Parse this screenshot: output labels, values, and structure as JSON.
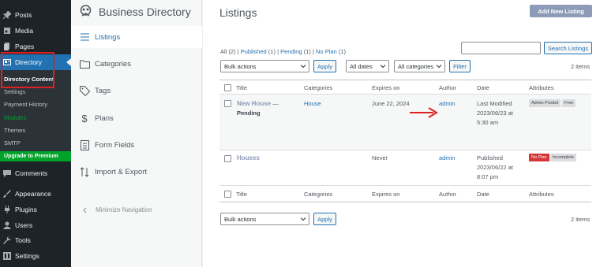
{
  "wp_menu": {
    "posts": "Posts",
    "media": "Media",
    "pages": "Pages",
    "directory": "Directory",
    "submenu": [
      "Directory Content",
      "Settings",
      "Payment History",
      "Modules",
      "Themes",
      "SMTP"
    ],
    "upgrade": "Upgrade to Premium",
    "comments": "Comments",
    "appearance": "Appearance",
    "plugins": "Plugins",
    "users": "Users",
    "tools": "Tools",
    "settings": "Settings"
  },
  "bd_nav": {
    "title": "Business Directory",
    "items": [
      "Listings",
      "Categories",
      "Tags",
      "Plans",
      "Form Fields",
      "Import & Export"
    ],
    "minimize": "Minimize Navigation"
  },
  "main": {
    "title": "Listings",
    "add_new": "Add New Listing",
    "filters": {
      "all": "All",
      "all_count": "(2)",
      "published": "Published",
      "published_count": "(1)",
      "pending": "Pending",
      "pending_count": "(1)",
      "no_plan": "No Plan",
      "no_plan_count": "(1)",
      "sep": "|"
    },
    "search_button": "Search Listings",
    "bulk_actions": "Bulk actions",
    "apply": "Apply",
    "all_dates": "All dates",
    "all_categories": "All categories",
    "filter": "Filter",
    "items_count": "2 items",
    "columns": [
      "Title",
      "Categories",
      "Expires on",
      "Author",
      "Date",
      "Attributes"
    ],
    "rows": [
      {
        "title": "New House",
        "dash": "—",
        "state": "Pending",
        "category": "House",
        "expires": "June 22, 2024",
        "author": "admin",
        "date_label": "Last Modified",
        "date": "2023/06/23 at",
        "time": "5:30 am",
        "badges": [
          "Admin Posted",
          "Free"
        ]
      },
      {
        "title": "Houses",
        "category": "",
        "expires": "Never",
        "author": "admin",
        "date_label": "Published",
        "date": "2023/06/22 at",
        "time": "8:07 pm",
        "badges": [
          "No Plan",
          "Incomplete"
        ]
      }
    ]
  },
  "colors": {
    "sidebar": "#1d2327",
    "accent": "#2271b1",
    "highlight": "#e02020",
    "upgrade": "#00a32a"
  }
}
